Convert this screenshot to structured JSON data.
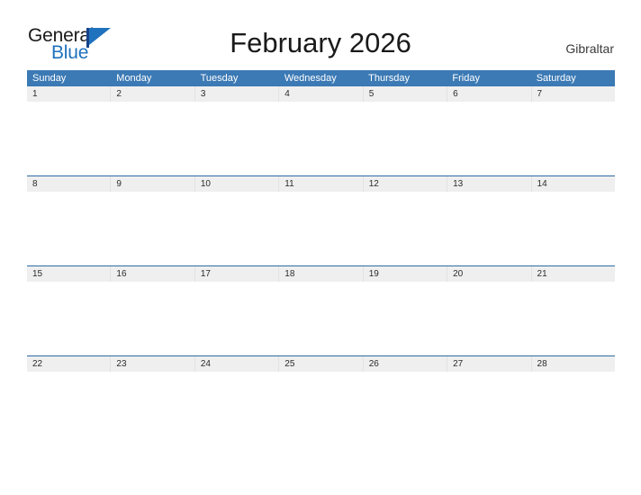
{
  "brand": {
    "word_one": "General",
    "word_two": "Blue",
    "flag_icon": "blue-flag-icon",
    "accent_color": "#1f72bd"
  },
  "header": {
    "title": "February 2026",
    "location": "Gibraltar"
  },
  "colors": {
    "header_blue": "#3c7ab5",
    "rule_blue": "#2e6da4",
    "date_band_gray": "#efefef",
    "title_text": "#1a1a1a",
    "location_text": "#3a3a3a"
  },
  "calendar": {
    "month": "February",
    "year": "2026",
    "weekday_headers": [
      "Sunday",
      "Monday",
      "Tuesday",
      "Wednesday",
      "Thursday",
      "Friday",
      "Saturday"
    ],
    "weeks": [
      {
        "dates": [
          "1",
          "2",
          "3",
          "4",
          "5",
          "6",
          "7"
        ]
      },
      {
        "dates": [
          "8",
          "9",
          "10",
          "11",
          "12",
          "13",
          "14"
        ]
      },
      {
        "dates": [
          "15",
          "16",
          "17",
          "18",
          "19",
          "20",
          "21"
        ]
      },
      {
        "dates": [
          "22",
          "23",
          "24",
          "25",
          "26",
          "27",
          "28"
        ]
      }
    ]
  }
}
